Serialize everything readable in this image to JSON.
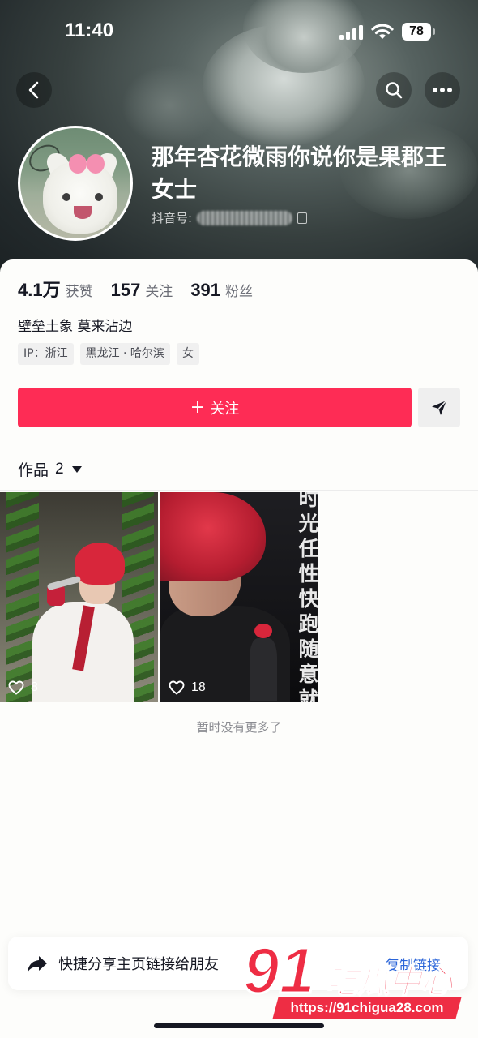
{
  "status_bar": {
    "time": "11:40",
    "battery": "78"
  },
  "profile": {
    "nickname": "那年杏花微雨你说你是果郡王女士",
    "douyin_id_label": "抖音号:",
    "bio": "壁垒土象 莫来沾边",
    "tags": [
      "IP：浙江",
      "黑龙江 · 哈尔滨",
      "女"
    ]
  },
  "stats": [
    {
      "value": "4.1万",
      "label": "获赞"
    },
    {
      "value": "157",
      "label": "关注"
    },
    {
      "value": "391",
      "label": "粉丝"
    }
  ],
  "actions": {
    "follow_label": "关注",
    "follow_plus": "+"
  },
  "works": {
    "tab_label": "作品",
    "count": "2",
    "items": [
      {
        "likes": "8"
      },
      {
        "likes": "18",
        "overlay_text": "时光任性快跑随意就转"
      }
    ],
    "end_text": "暂时没有更多了"
  },
  "share_bar": {
    "label": "快捷分享主页链接给朋友",
    "copy_label": "复制链接"
  },
  "watermark": {
    "logo_number": "91",
    "logo_name": "吃瓜中心",
    "url": "https://91chigua28.com"
  },
  "icons": {
    "back": "chevron-left-icon",
    "search": "search-icon",
    "more": "more-dots-icon",
    "send": "send-icon",
    "like": "heart-icon",
    "share": "share-arrow-icon"
  },
  "colors": {
    "accent": "#fe2c55",
    "link": "#2b65d9",
    "watermark": "#ee2d44"
  }
}
